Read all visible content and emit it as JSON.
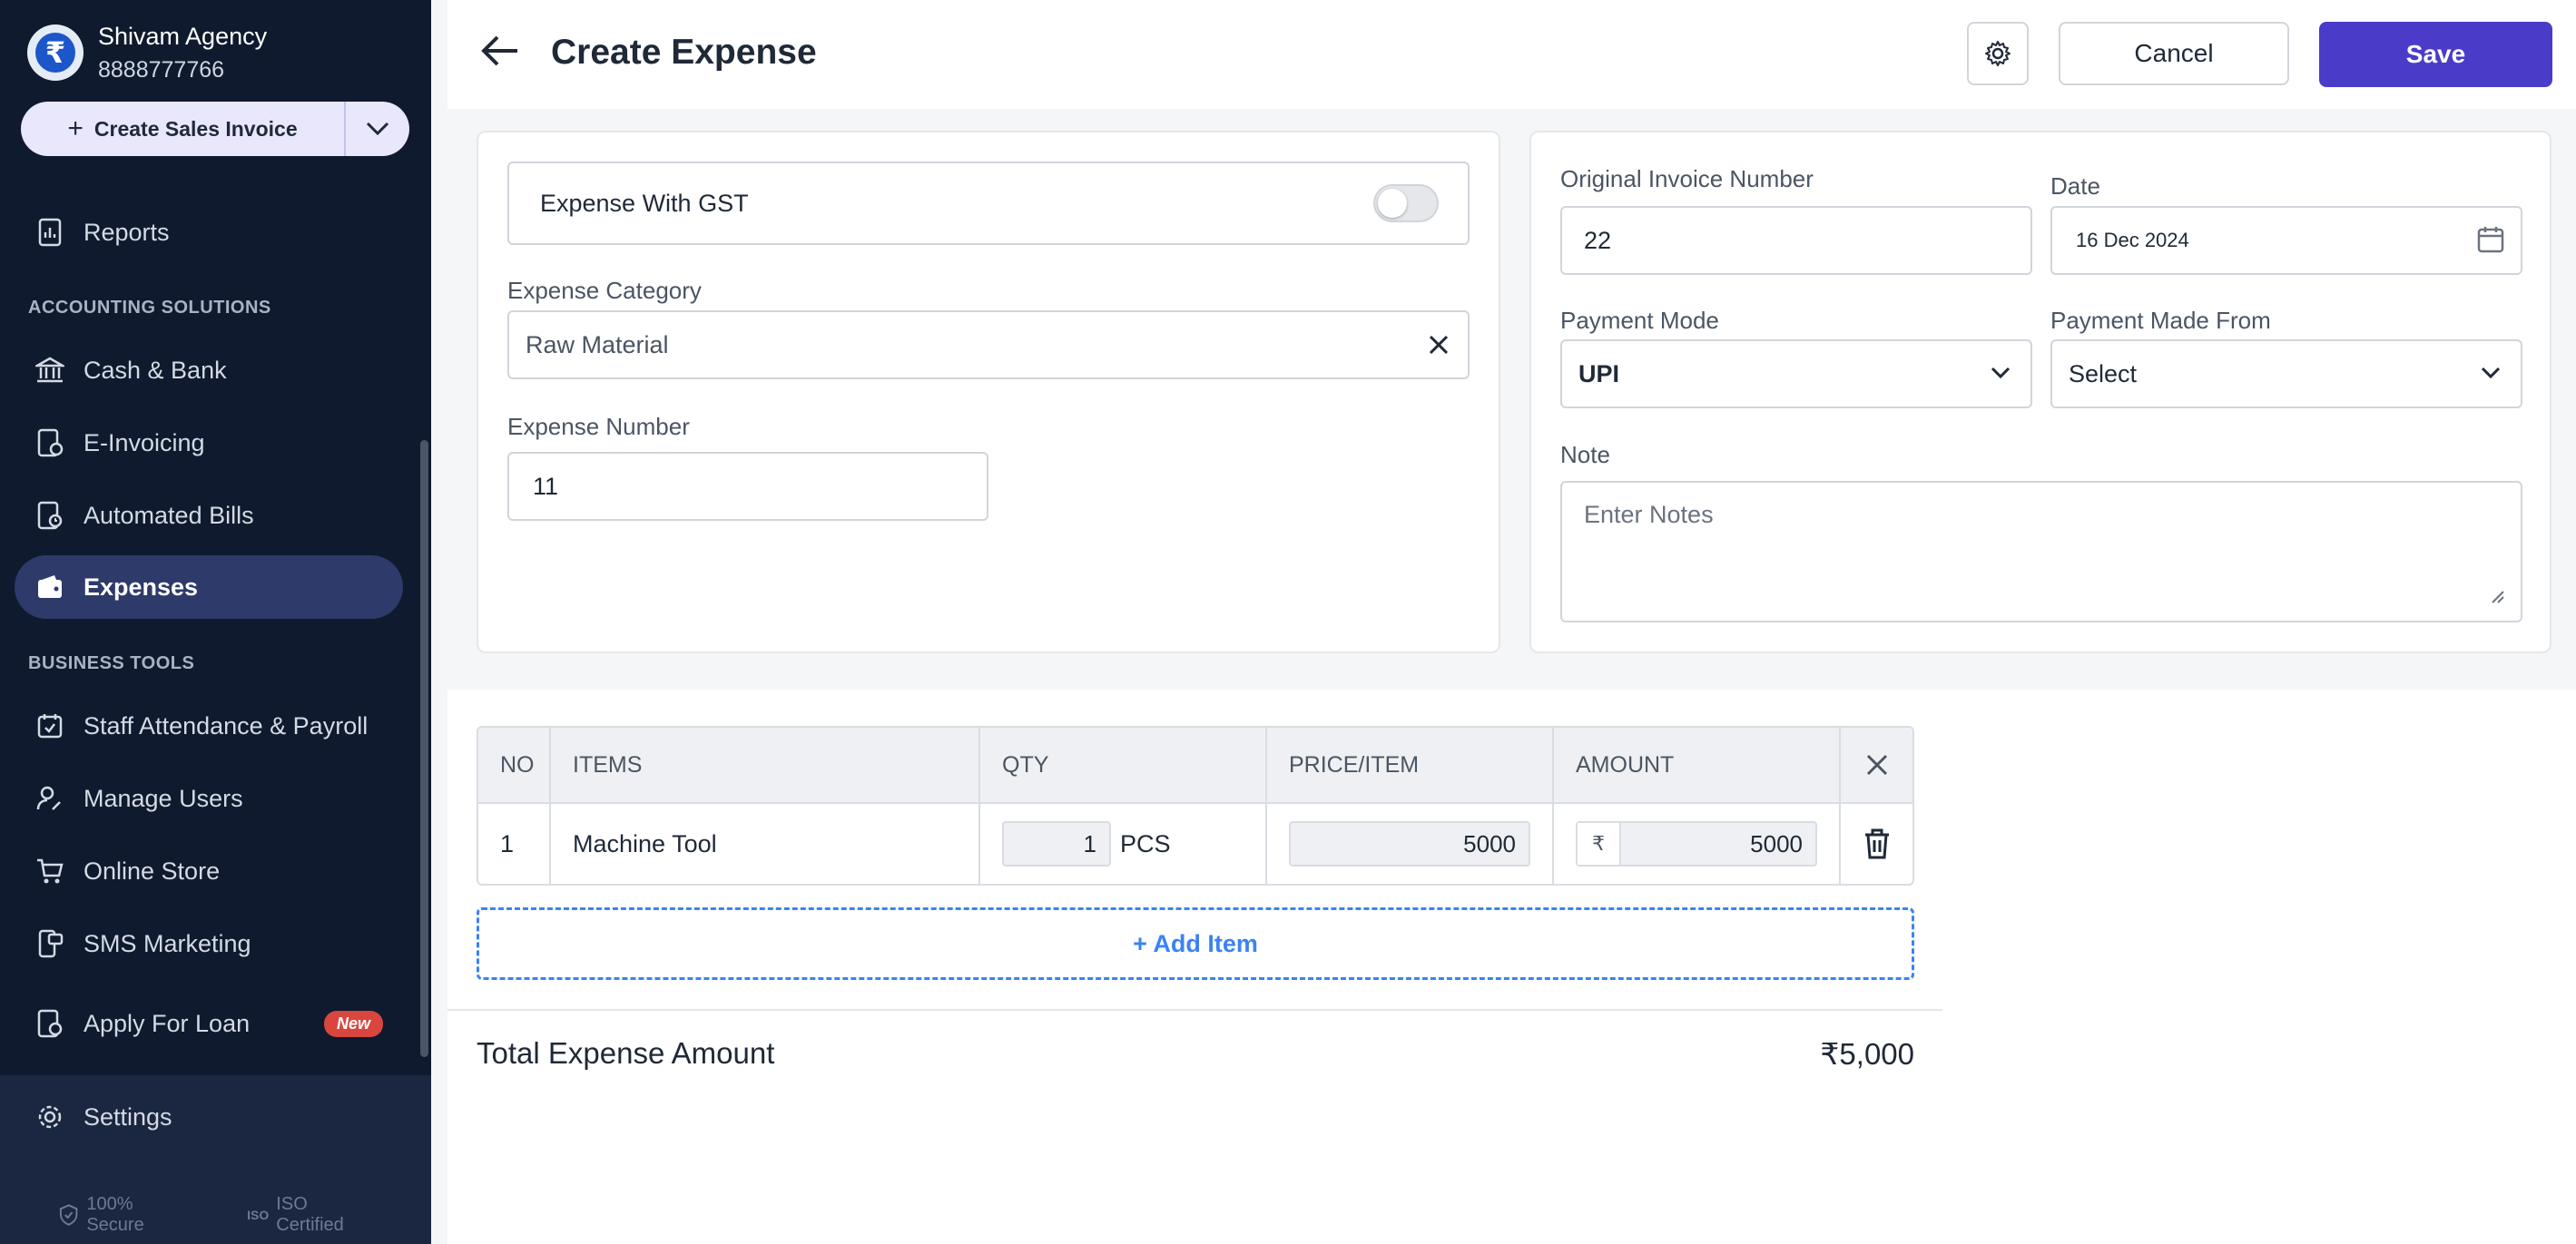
{
  "business": {
    "name": "Shivam Agency",
    "phone": "8888777766"
  },
  "create_button": {
    "label": "Create Sales Invoice"
  },
  "sidebar": {
    "items": [
      {
        "label": "Reports"
      },
      {
        "label": "Cash & Bank"
      },
      {
        "label": "E-Invoicing"
      },
      {
        "label": "Automated Bills"
      },
      {
        "label": "Expenses"
      },
      {
        "label": "Staff Attendance & Payroll"
      },
      {
        "label": "Manage Users"
      },
      {
        "label": "Online Store"
      },
      {
        "label": "SMS Marketing"
      },
      {
        "label": "Apply For Loan",
        "badge": "New"
      }
    ],
    "sections": {
      "accounting": "ACCOUNTING SOLUTIONS",
      "business_tools": "BUSINESS TOOLS"
    },
    "settings_label": "Settings",
    "footer": {
      "secure": "100% Secure",
      "iso": "ISO Certified",
      "iso_badge": "ISO"
    }
  },
  "header": {
    "title": "Create Expense",
    "cancel_label": "Cancel",
    "save_label": "Save"
  },
  "form": {
    "gst_label": "Expense With GST",
    "category_label": "Expense Category",
    "category_value": "Raw Material",
    "number_label": "Expense Number",
    "number_value": "11",
    "invoice_label": "Original Invoice Number",
    "invoice_value": "22",
    "date_label": "Date",
    "date_value": "16 Dec 2024",
    "payment_mode_label": "Payment Mode",
    "payment_mode_value": "UPI",
    "payment_from_label": "Payment Made From",
    "payment_from_value": "Select",
    "note_label": "Note",
    "note_placeholder": "Enter Notes"
  },
  "table": {
    "headers": {
      "no": "NO",
      "items": "ITEMS",
      "qty": "QTY",
      "price": "PRICE/ITEM",
      "amount": "AMOUNT"
    },
    "rows": [
      {
        "no": "1",
        "item": "Machine Tool",
        "qty": "1",
        "unit": "PCS",
        "price": "5000",
        "currency": "₹",
        "amount": "5000"
      }
    ],
    "add_item_label": "+ Add Item"
  },
  "total": {
    "label": "Total Expense Amount",
    "value": "₹5,000"
  },
  "colors": {
    "accent": "#4a3bc8",
    "sidebar_bg": "#0f1a2e",
    "link": "#3b82f6",
    "badge": "#d9463e"
  }
}
